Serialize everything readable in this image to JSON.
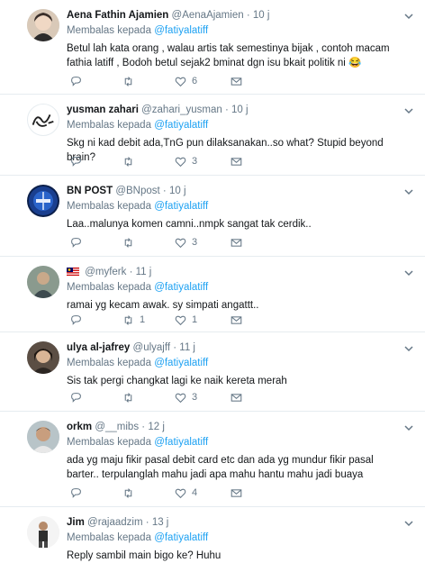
{
  "tweets": [
    {
      "name": "Aena Fathin Ajamien",
      "handle": "@AenaAjamien",
      "time": "10 j",
      "reply_label": "Membalas kepada",
      "reply_to": "@fatiyalatiff",
      "text": "Betul lah kata orang , walau artis tak semestinya bijak , contoh macam fathia latiff , Bodoh betul sejak2 bminat dgn isu bkait politik ni 😂",
      "replies": "",
      "retweets": "",
      "likes": "6"
    },
    {
      "name": "yusman zahari",
      "handle": "@zahari_yusman",
      "time": "10 j",
      "reply_label": "Membalas kepada",
      "reply_to": "@fatiyalatiff",
      "text": "Skg ni kad debit ada,TnG pun dilaksanakan..so what? Stupid beyond brain?",
      "replies": "",
      "retweets": "",
      "likes": "3"
    },
    {
      "name": "BN POST",
      "handle": "@BNpost",
      "time": "10 j",
      "reply_label": "Membalas kepada",
      "reply_to": "@fatiyalatiff",
      "text": "Laa..malunya komen camni..nmpk sangat tak cerdik..",
      "replies": "",
      "retweets": "",
      "likes": "3"
    },
    {
      "name": "",
      "handle": "@myferk",
      "time": "11 j",
      "reply_label": "Membalas kepada",
      "reply_to": "@fatiyalatiff",
      "text": "ramai yg kecam awak. sy simpati angattt..",
      "replies": "",
      "retweets": "1",
      "likes": "1"
    },
    {
      "name": "ulya al-jafrey",
      "handle": "@ulyajff",
      "time": "11 j",
      "reply_label": "Membalas kepada",
      "reply_to": "@fatiyalatiff",
      "text": "Sis tak pergi changkat lagi ke naik kereta merah",
      "replies": "",
      "retweets": "",
      "likes": "3"
    },
    {
      "name": "orkm",
      "handle": "@__mibs",
      "time": "12 j",
      "reply_label": "Membalas kepada",
      "reply_to": "@fatiyalatiff",
      "text": "ada yg maju fikir pasal debit card etc dan ada yg mundur fikir pasal barter.. terpulanglah mahu jadi apa mahu hantu mahu jadi buaya",
      "replies": "",
      "retweets": "",
      "likes": "4"
    },
    {
      "name": "Jim",
      "handle": "@rajaadzim",
      "time": "13 j",
      "reply_label": "Membalas kepada",
      "reply_to": "@fatiyalatiff",
      "text": "Reply sambil main bigo ke? Huhu",
      "replies": "",
      "retweets": "",
      "likes": ""
    }
  ],
  "dot": "·",
  "icons": {
    "reply": "reply-icon",
    "retweet": "retweet-icon",
    "like": "heart-icon",
    "dm": "envelope-icon",
    "menu": "chevron-down-icon",
    "flag": "malaysia-flag-icon"
  },
  "colors": {
    "link": "#1da1f2",
    "muted": "#657786",
    "text": "#14171a",
    "divider": "#e6ecf0"
  }
}
